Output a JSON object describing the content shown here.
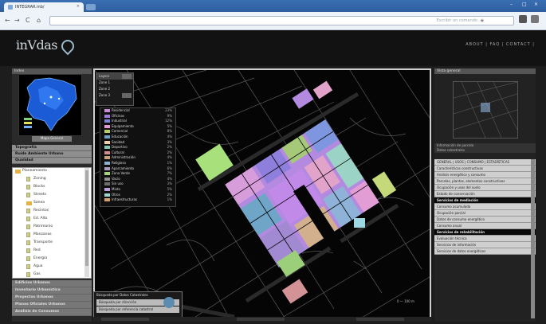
{
  "browser": {
    "tab_title": "INTEGRAR.mb/",
    "tab_close": "×",
    "win_controls": [
      "–",
      "□",
      "×"
    ],
    "nav": [
      "←",
      "→",
      "C",
      "⌂"
    ],
    "address_placeholder": "Escribir un comando",
    "star": "★"
  },
  "header": {
    "logo": "inVdas",
    "logo_subtitle": "",
    "nav": "ABOUT | FAQ | CONTACT |"
  },
  "left": {
    "minimap_title": "Index",
    "minimap_button": "Mapa General",
    "accordion": [
      "Topografía",
      "Ruído Ambiente Urbano",
      "Qualidad"
    ],
    "tree": [
      {
        "label": "Planeamiento",
        "type": "root"
      },
      {
        "label": "Zoning",
        "type": "doc"
      },
      {
        "label": "Blocks",
        "type": "doc"
      },
      {
        "label": "Streets",
        "type": "doc"
      },
      {
        "label": "Sanea",
        "type": "fold"
      },
      {
        "label": "Recintos",
        "type": "doc"
      },
      {
        "label": "Ed. Alto",
        "type": "doc"
      },
      {
        "label": "Patrimonio",
        "type": "doc"
      },
      {
        "label": "Manzanas",
        "type": "doc"
      },
      {
        "label": "Transporte",
        "type": "doc"
      },
      {
        "label": "Red",
        "type": "doc"
      },
      {
        "label": "Energía",
        "type": "doc"
      },
      {
        "label": "Agua",
        "type": "doc"
      },
      {
        "label": "Gas",
        "type": "doc"
      }
    ],
    "bottom_accordion": [
      "Edificios Urbanos",
      "Inventario Urbanístico",
      "Proyectos Urbanos",
      "Planos Oficiales Urbanos",
      "Análisis de Consumos"
    ]
  },
  "map": {
    "layers": [
      "Layers",
      "Zone 1",
      "Zone 2",
      "Zone 3"
    ],
    "legend": [
      {
        "label": "Residencial",
        "value": "23%",
        "color": "#c98ad8"
      },
      {
        "label": "Oficinas",
        "value": "9%",
        "color": "#9f7ad9"
      },
      {
        "label": "Industrial",
        "value": "12%",
        "color": "#7f86d8"
      },
      {
        "label": "Equipamiento",
        "value": "5%",
        "color": "#e39bd0"
      },
      {
        "label": "Comercial",
        "value": "8%",
        "color": "#b6cf6a"
      },
      {
        "label": "Educación",
        "value": "4%",
        "color": "#6fa0c6"
      },
      {
        "label": "Sanidad",
        "value": "3%",
        "color": "#f1cfa8"
      },
      {
        "label": "Deportivo",
        "value": "2%",
        "color": "#87c9b5"
      },
      {
        "label": "Cultural",
        "value": "2%",
        "color": "#d48b92"
      },
      {
        "label": "Administración",
        "value": "4%",
        "color": "#c9a27a"
      },
      {
        "label": "Religioso",
        "value": "1%",
        "color": "#8cb1d0"
      },
      {
        "label": "Aparcamiento",
        "value": "6%",
        "color": "#a99bbf"
      },
      {
        "label": "Zona Verde",
        "value": "7%",
        "color": "#a4d47c"
      },
      {
        "label": "Vacío",
        "value": "4%",
        "color": "#909090"
      },
      {
        "label": "Sin uso",
        "value": "3%",
        "color": "#6e6e6e"
      },
      {
        "label": "Mixto",
        "value": "5%",
        "color": "#bba0de"
      },
      {
        "label": "Otros",
        "value": "2%",
        "color": "#9dd6cf"
      },
      {
        "label": "Infraestructuras",
        "value": "1%",
        "color": "#d7a06e"
      }
    ],
    "search_title": "Búsqueda por Datos Catastrales",
    "search_options": [
      "Búsqueda por dirección",
      "Búsqueda por referencia catastral"
    ],
    "scale": "0 — 100 m"
  },
  "right": {
    "thumb_title": "Vista general",
    "tabs": [
      "Información de parcela",
      "Datos catastrales"
    ],
    "list": [
      {
        "label": "GENERAL | USOS | CONSUMO | ESTADÍSTICAS",
        "type": "item"
      },
      {
        "label": "Características constructivas",
        "type": "item"
      },
      {
        "label": "Análisis energético y consumo",
        "type": "item"
      },
      {
        "label": "Parcelas, plantas, elementos constructivos",
        "type": "item"
      },
      {
        "label": "Ocupación y usos del suelo",
        "type": "item"
      },
      {
        "label": "Estado de conservación",
        "type": "item"
      },
      {
        "label": "Servicios de mediación",
        "type": "head"
      },
      {
        "label": "Consumo acumulado",
        "type": "item"
      },
      {
        "label": "Ocupación parcial",
        "type": "item"
      },
      {
        "label": "Datos de consumo energético",
        "type": "item"
      },
      {
        "label": "Consumo anual",
        "type": "item"
      },
      {
        "label": "Servicios de rehabilitación",
        "type": "head"
      },
      {
        "label": "Evaluación técnica",
        "type": "item"
      },
      {
        "label": "Servicios de información",
        "type": "item"
      },
      {
        "label": "Servicios de datos energéticos",
        "type": "item"
      }
    ]
  }
}
